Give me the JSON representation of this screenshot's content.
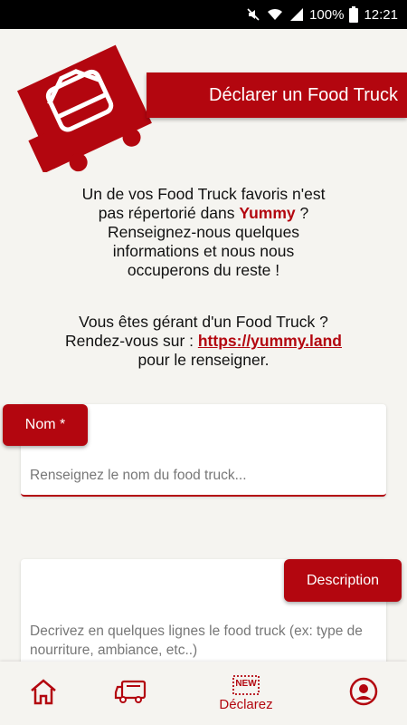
{
  "status": {
    "battery": "100%",
    "time": "12:21"
  },
  "header": {
    "title": "Déclarer un Food Truck"
  },
  "intro": {
    "line1": "Un de vos Food Truck favoris n'est",
    "line2_pre": "pas répertorié dans ",
    "brand": "Yummy",
    "line2_post": " ?",
    "line3": "Renseignez-nous quelques",
    "line4": "informations et nous nous",
    "line5": "occuperons du reste !"
  },
  "manager": {
    "line1": "Vous êtes gérant d'un Food Truck ?",
    "line2_pre": "Rendez-vous sur : ",
    "link": "https://yummy.land",
    "line3": "pour le renseigner."
  },
  "form": {
    "name": {
      "label": "Nom *",
      "placeholder": "Renseignez le nom du food truck..."
    },
    "description": {
      "label": "Description",
      "placeholder": "Decrivez en quelques lignes le food truck (ex: type de nourriture, ambiance, etc..)"
    }
  },
  "nav": {
    "home_icon": "home-icon",
    "trucks_icon": "food-truck-icon",
    "declare_badge": "NEW",
    "declare_label": "Déclarez",
    "profile_icon": "user-circle-icon"
  },
  "colors": {
    "accent": "#b3060f",
    "background": "#f5f4f0"
  }
}
